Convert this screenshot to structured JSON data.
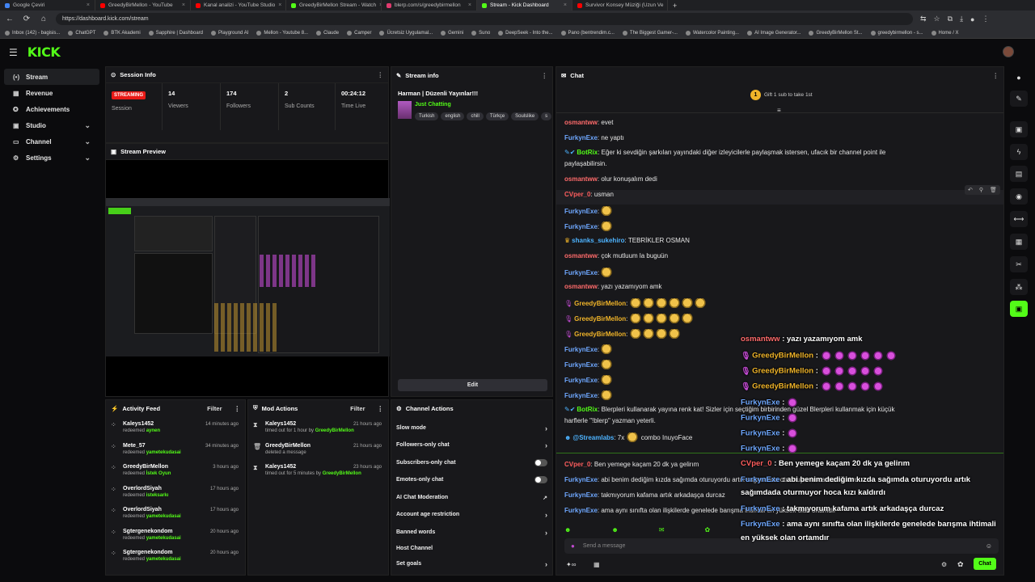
{
  "browser": {
    "tabs": [
      {
        "title": "Google Çeviri",
        "color": "#4285f4"
      },
      {
        "title": "GreedyBirMellon - YouTube",
        "color": "#ff0000"
      },
      {
        "title": "Kanal analizi - YouTube Studio",
        "color": "#ff0000"
      },
      {
        "title": "GreedyBirMellon Stream - Watch",
        "color": "#53fc18"
      },
      {
        "title": "blerp.com/s/greedybirmellon",
        "color": "#e03a6e"
      },
      {
        "title": "Stream - Kick Dashboard",
        "color": "#53fc18"
      },
      {
        "title": "Survivor Konsey Müziği (Uzun Ve",
        "color": "#ff0000"
      }
    ],
    "new_tab": "+",
    "url": "https://dashboard.kick.com/stream",
    "bookmarks": [
      "Inbox (142) - bagisis...",
      "ChatGPT",
      "BTK Akademi",
      "Sapphire | Dashboard",
      "Playground AI",
      "Mellon - Youtube 8...",
      "Claude",
      "Camper",
      "Ücretsiz Uygulamal...",
      "Gemini",
      "Suno",
      "DeepSeek - Into the...",
      "Pano (bentrendim.c...",
      "The Biggest Gamer-...",
      "Watercolor Painting...",
      "AI Image Generator...",
      "GreedyBirMellon St...",
      "greedybirmellon - s...",
      "Home / X"
    ]
  },
  "app": {
    "logo": "KICK"
  },
  "sidebar": {
    "items": [
      {
        "label": "Stream",
        "icon": "(•)"
      },
      {
        "label": "Revenue",
        "icon": "▦"
      },
      {
        "label": "Achievements",
        "icon": "✪"
      },
      {
        "label": "Studio",
        "icon": "▣"
      },
      {
        "label": "Channel",
        "icon": "▭"
      },
      {
        "label": "Settings",
        "icon": "⚙"
      }
    ]
  },
  "session": {
    "title": "Session Info",
    "status": "STREAMING",
    "status_label": "Session",
    "viewers": "14",
    "viewers_label": "Viewers",
    "followers": "174",
    "followers_label": "Followers",
    "subs": "2",
    "subs_label": "Sub Counts",
    "time": "00:24:12",
    "time_label": "Time Live"
  },
  "preview": {
    "title": "Stream Preview"
  },
  "streaminfo": {
    "title": "Stream info",
    "stream_title": "Harman | Düzenli Yayınlar!!!",
    "category": "Just Chatting",
    "tags": [
      "Turkish",
      "english",
      "chill",
      "Türkçe",
      "Soulslike",
      "s"
    ],
    "edit": "Edit"
  },
  "activity": {
    "title": "Activity Feed",
    "filter": "Filter",
    "items": [
      {
        "name": "Kaleys1452",
        "action": "redeemed",
        "reward": "aynen",
        "time": "14 minutes ago"
      },
      {
        "name": "Mete_57",
        "action": "redeemed",
        "reward": "yametekudasai",
        "time": "34 minutes ago"
      },
      {
        "name": "GreedyBirMellon",
        "action": "redeemed",
        "reward": "İstek Oyun",
        "time": "3 hours ago"
      },
      {
        "name": "OverlordSiyah",
        "action": "redeemed",
        "reward": "isteksarkı",
        "time": "17 hours ago"
      },
      {
        "name": "OverlordSiyah",
        "action": "redeemed",
        "reward": "yametekudasai",
        "time": "17 hours ago"
      },
      {
        "name": "Sgtergenekondom",
        "action": "redeemed",
        "reward": "yametekudasai",
        "time": "20 hours ago"
      },
      {
        "name": "Sgtergenekondom",
        "action": "redeemed",
        "reward": "yametekudasai",
        "time": "20 hours ago"
      }
    ]
  },
  "mod": {
    "title": "Mod Actions",
    "filter": "Filter",
    "items": [
      {
        "name": "Kaleys1452",
        "detail": "timed out for 1 hour by",
        "by": "GreedyBirMellon",
        "time": "21 hours ago"
      },
      {
        "name": "GreedyBirMellon",
        "detail": "deleted a message",
        "by": "",
        "time": "21 hours ago"
      },
      {
        "name": "Kaleys1452",
        "detail": "timed out for 5 minutes by",
        "by": "GreedyBirMellon",
        "time": "23 hours ago"
      }
    ]
  },
  "channel_actions": {
    "title": "Channel Actions",
    "items": [
      "Slow mode",
      "Followers-only chat",
      "Subscribers-only chat",
      "Emotes-only chat",
      "AI Chat Moderation",
      "Account age restriction",
      "Banned words",
      "Host Channel",
      "Set goals"
    ]
  },
  "chat": {
    "title": "Chat",
    "gift_count": "1",
    "gift_text": "Gift 1 sub to take 1st",
    "messages": [
      {
        "user": "osmantww",
        "color": "#ff6b6b",
        "text": ": evet"
      },
      {
        "user": "FurkynExe",
        "color": "#6fa8ff",
        "text": ": ne yaptı"
      },
      {
        "user": "BotRix",
        "color": "#53fc18",
        "text": ": Eğer ki sevdiğin şarkıları yayındaki diğer izleyicilerle paylaşmak istersen, ufacık bir channel point ile"
      },
      {
        "user": "",
        "color": "#e6e6e6",
        "text": "paylaşabilirsin."
      },
      {
        "user": "osmantww",
        "color": "#ff6b6b",
        "text": ": olur konuşalım dedi"
      },
      {
        "user": "CVper_0",
        "color": "#ff5e5e",
        "text": ": usman"
      },
      {
        "user": "FurkynExe",
        "color": "#6fa8ff",
        "text": ":"
      },
      {
        "user": "FurkynExe",
        "color": "#6fa8ff",
        "text": ":"
      },
      {
        "user": "shanks_sukehiro",
        "color": "#4db3ff",
        "text": ": TEBRİKLER OSMAN"
      },
      {
        "user": "osmantww",
        "color": "#ff6b6b",
        "text": ": çok mutluum la buguün"
      },
      {
        "user": "FurkynExe",
        "color": "#6fa8ff",
        "text": ":"
      },
      {
        "user": "osmantww",
        "color": "#ff6b6b",
        "text": ": yazı yazamıyom amk"
      },
      {
        "user": "GreedyBirMellon",
        "color": "#f0b429",
        "text": ":"
      },
      {
        "user": "GreedyBirMellon",
        "color": "#f0b429",
        "text": ":"
      },
      {
        "user": "GreedyBirMellon",
        "color": "#f0b429",
        "text": ":"
      },
      {
        "user": "FurkynExe",
        "color": "#6fa8ff",
        "text": ":"
      },
      {
        "user": "FurkynExe",
        "color": "#6fa8ff",
        "text": ":"
      },
      {
        "user": "FurkynExe",
        "color": "#6fa8ff",
        "text": ":"
      },
      {
        "user": "FurkynExe",
        "color": "#6fa8ff",
        "text": ":"
      },
      {
        "user": "BotRix",
        "color": "#53fc18",
        "text": ": Blerpleri kullanarak yayına renk kat! Sizler için seçtiğim birbirinden güzel Blerpleri kullanmak için küçük"
      },
      {
        "user": "",
        "color": "#e6e6e6",
        "text": "harflerle \"!blerp\" yazman yeterli."
      },
      {
        "user": "@Streamlabs",
        "color": "#4db3ff",
        "text": ": 7x"
      },
      {
        "user": "CVper_0",
        "color": "#ff5e5e",
        "text": ": Ben yemege kaçam 20 dk ya gelirım"
      },
      {
        "user": "FurkynExe",
        "color": "#6fa8ff",
        "text": ": abi benim dediğim kızda sağımda oturuyordu artık sağımdada oturmuyor hoca kızı kaldırdı"
      },
      {
        "user": "FurkynExe",
        "color": "#6fa8ff",
        "text": ": takmıyorum kafama artık arkadaşça durcaz"
      },
      {
        "user": "FurkynExe",
        "color": "#6fa8ff",
        "text": ": ama aynı sınıfta olan ilişkilerde genelede barışma ihtimali en yüksek olan ortamdır"
      }
    ],
    "combo_suffix": "combo InuyoFace",
    "input_placeholder": "Send a message",
    "send": "Chat"
  },
  "overlay": {
    "lines": [
      {
        "user": "osmantww",
        "color": "#ff6b6b",
        "text": " : yazı yazamıyom amk"
      },
      {
        "user": "GreedyBirMellon",
        "color": "#f0b429",
        "text": " :"
      },
      {
        "user": "GreedyBirMellon",
        "color": "#f0b429",
        "text": " :"
      },
      {
        "user": "GreedyBirMellon",
        "color": "#f0b429",
        "text": " :"
      },
      {
        "user": "FurkynExe",
        "color": "#6fa8ff",
        "text": " :"
      },
      {
        "user": "FurkynExe",
        "color": "#6fa8ff",
        "text": " :"
      },
      {
        "user": "FurkynExe",
        "color": "#6fa8ff",
        "text": " :"
      },
      {
        "user": "FurkynExe",
        "color": "#6fa8ff",
        "text": " :"
      },
      {
        "user": "CVper_0",
        "color": "#ff5e5e",
        "text": " : Ben yemege kaçam 20 dk ya gelirım"
      },
      {
        "user": "FurkynExe",
        "color": "#6fa8ff",
        "text": " : abi benim dediğim kızda sağımda oturuyordu artık"
      },
      {
        "user": "",
        "color": "#ffffff",
        "text": "sağımdada oturmuyor hoca kızı kaldırdı"
      },
      {
        "user": "FurkynExe",
        "color": "#6fa8ff",
        "text": " : takmıyorum kafama artık arkadaşça durcaz"
      },
      {
        "user": "FurkynExe",
        "color": "#6fa8ff",
        "text": " : ama aynı sınıfta olan ilişkilerde genelede barışma ihtimali"
      },
      {
        "user": "",
        "color": "#ffffff",
        "text": "en yüksek olan ortamdır"
      }
    ]
  },
  "colors": {
    "accent": "#53fc18",
    "live": "#e91916"
  }
}
